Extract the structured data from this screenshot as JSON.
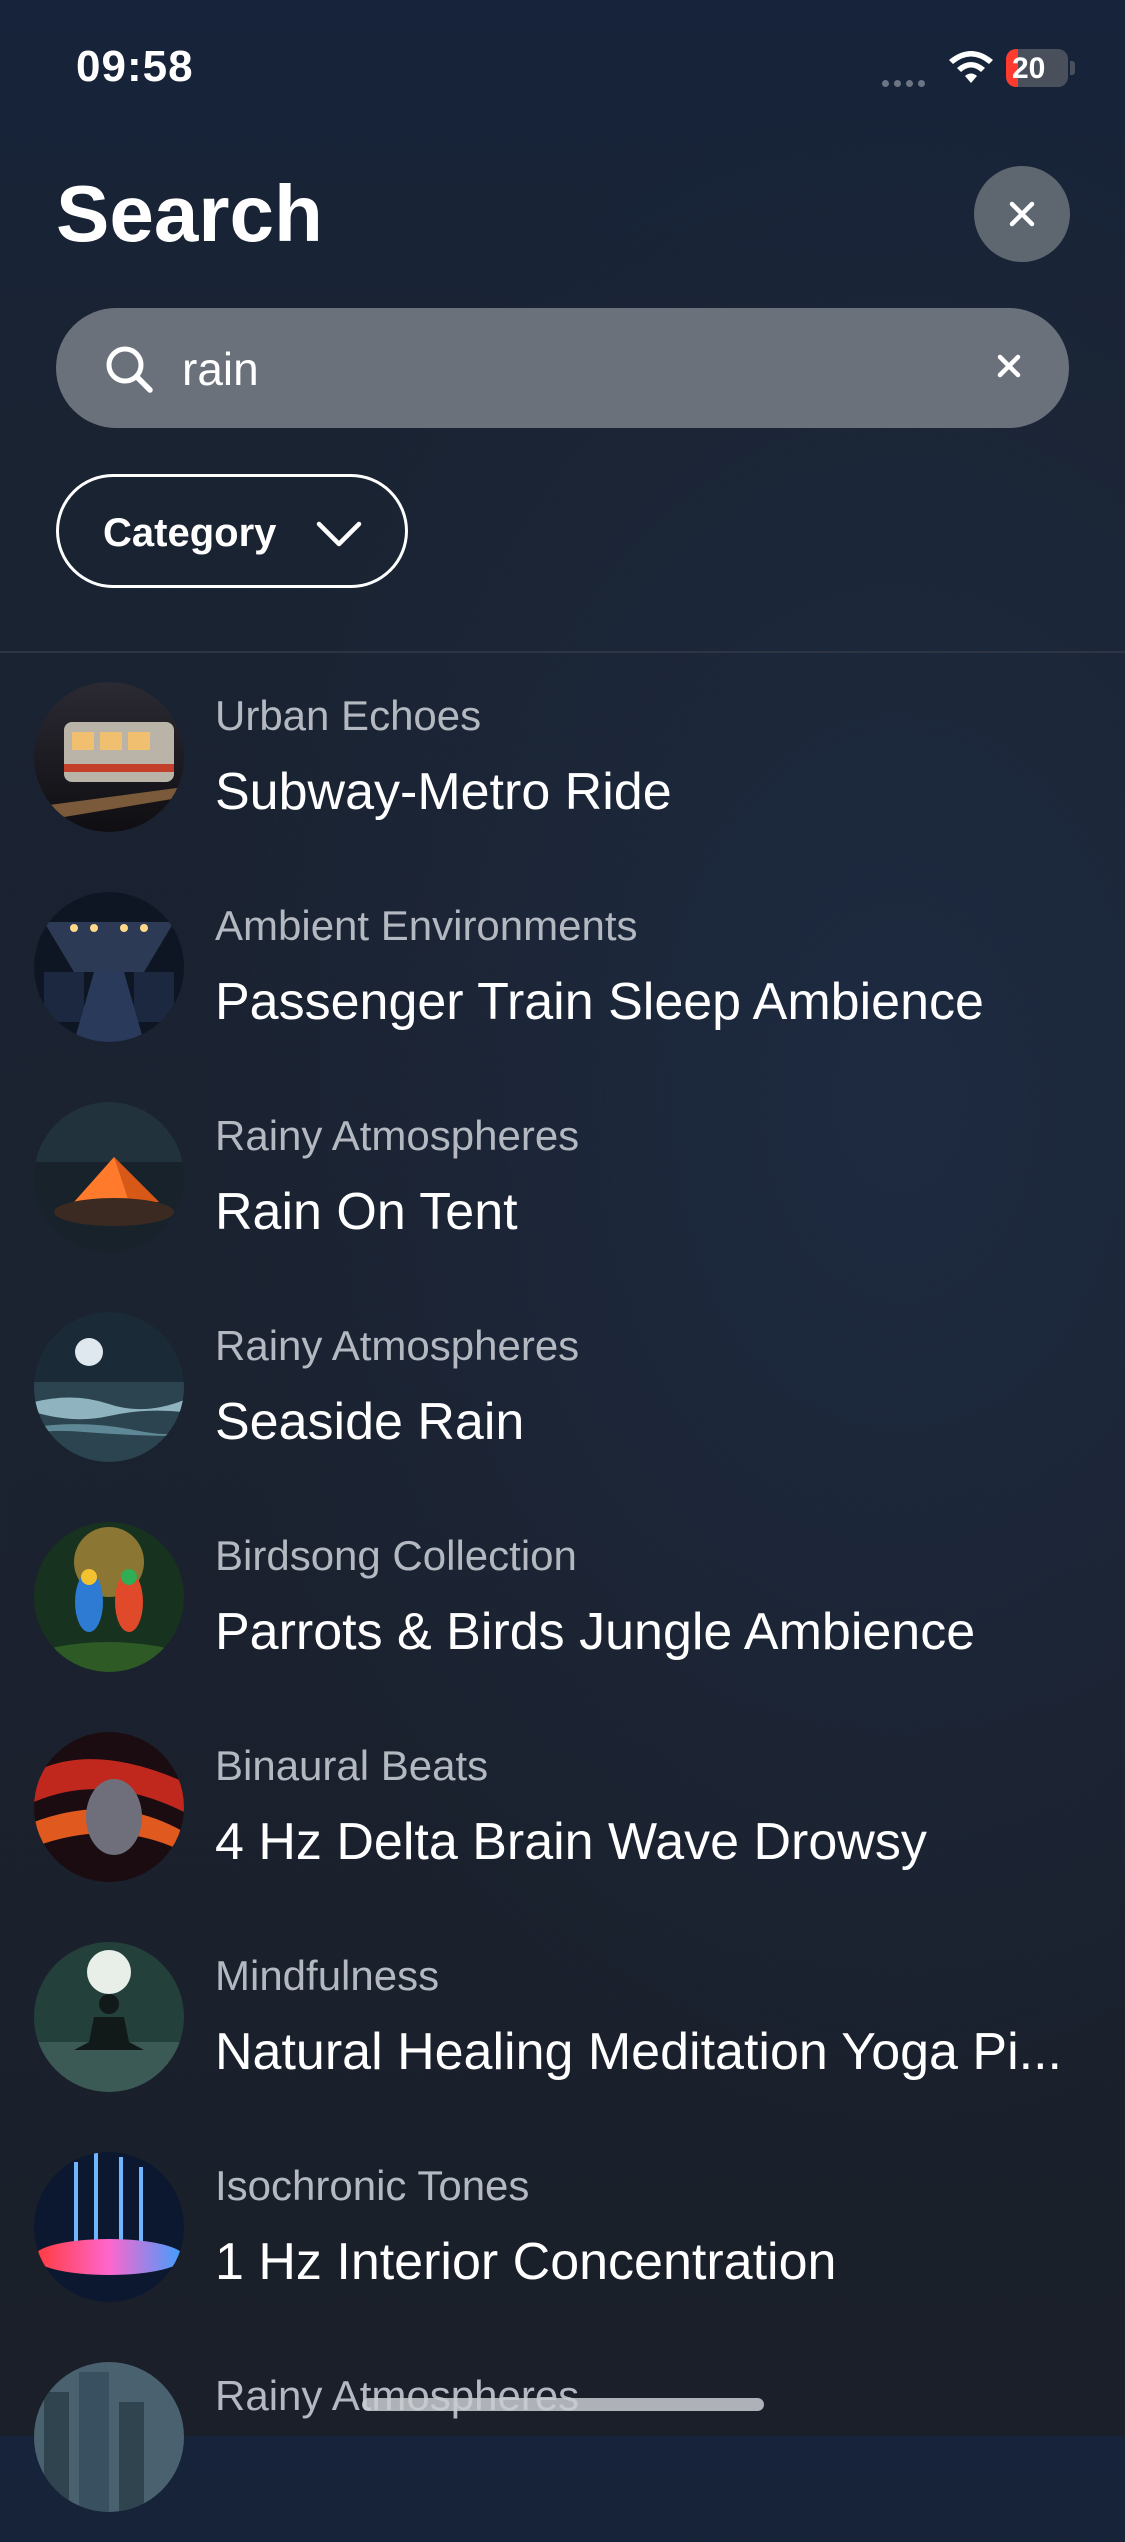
{
  "status_bar": {
    "time": "09:58",
    "battery": "20",
    "battery_level": 0.2
  },
  "header": {
    "title": "Search"
  },
  "search": {
    "value": "rain"
  },
  "filter": {
    "category_label": "Category"
  },
  "results": [
    {
      "category": "Urban Echoes",
      "title": "Subway-Metro Ride"
    },
    {
      "category": "Ambient Environments",
      "title": "Passenger Train Sleep Ambience"
    },
    {
      "category": "Rainy Atmospheres",
      "title": "Rain On Tent"
    },
    {
      "category": "Rainy Atmospheres",
      "title": "Seaside Rain"
    },
    {
      "category": "Birdsong Collection",
      "title": "Parrots & Birds Jungle Ambience"
    },
    {
      "category": "Binaural Beats",
      "title": "4 Hz Delta Brain Wave Drowsy"
    },
    {
      "category": "Mindfulness",
      "title": "Natural Healing Meditation Yoga Pi..."
    },
    {
      "category": "Isochronic Tones",
      "title": "1 Hz Interior Concentration"
    },
    {
      "category": "Rainy Atmospheres",
      "title": ""
    }
  ],
  "colors": {
    "accent_battery": "#ff3b30",
    "background": "#1b2230"
  }
}
